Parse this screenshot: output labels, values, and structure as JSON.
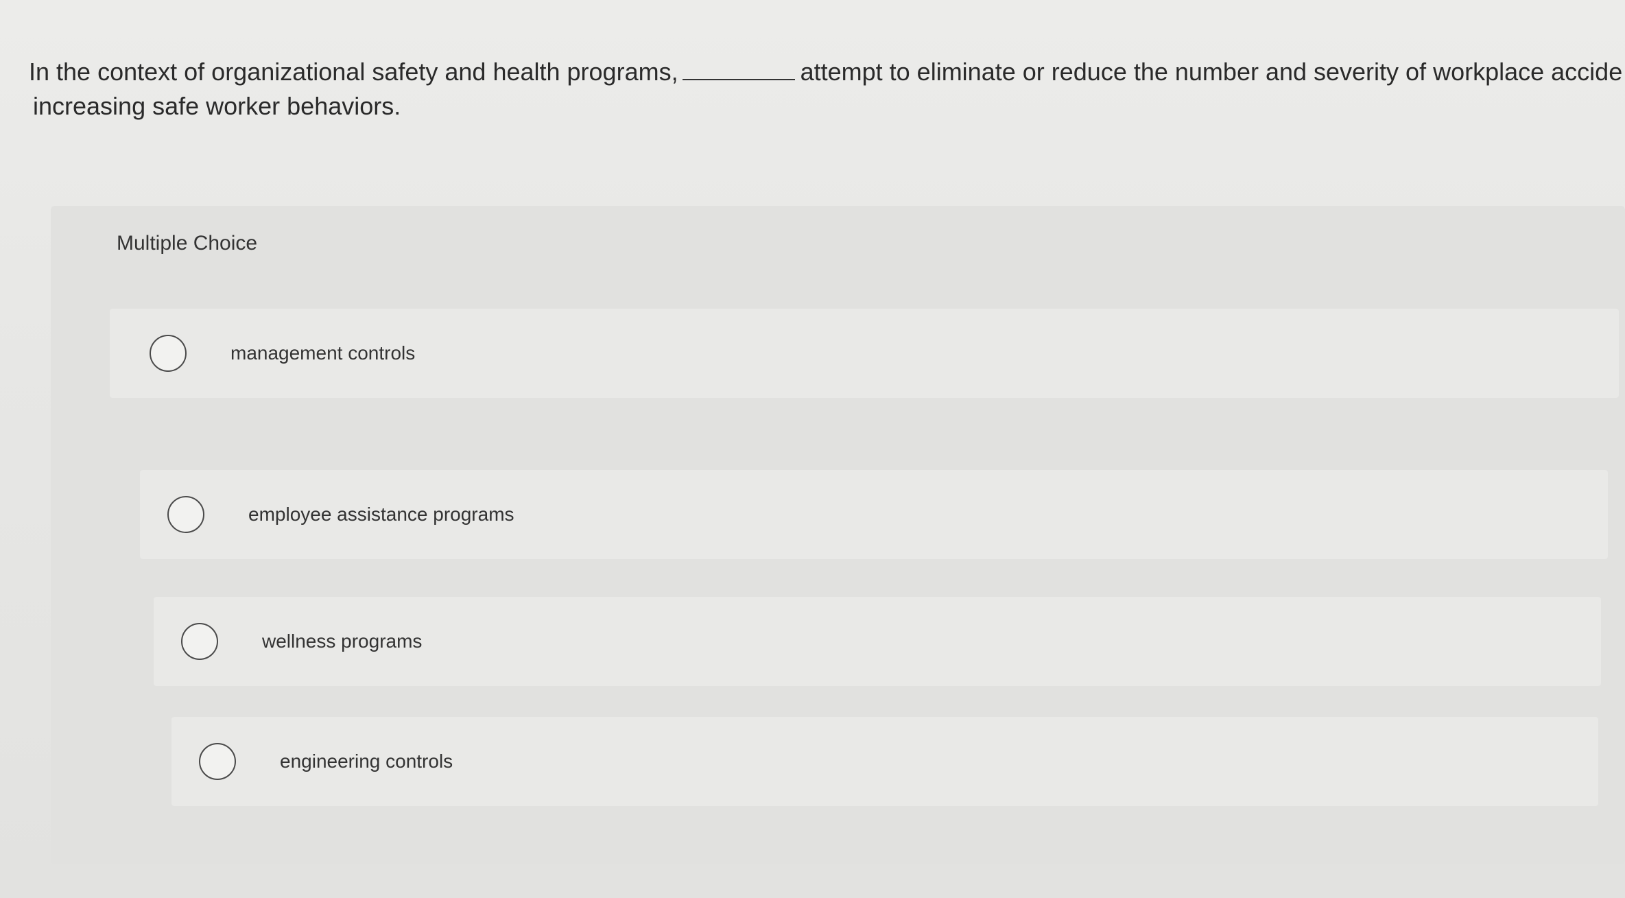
{
  "question": {
    "line1_before": "In the context of organizational safety and health programs,",
    "line1_after": "attempt to eliminate or reduce the number and severity of workplace accide",
    "line2": "increasing safe worker behaviors."
  },
  "multiple_choice": {
    "header": "Multiple Choice",
    "options": [
      {
        "label": "management controls"
      },
      {
        "label": "employee assistance programs"
      },
      {
        "label": "wellness programs"
      },
      {
        "label": "engineering controls"
      }
    ]
  }
}
